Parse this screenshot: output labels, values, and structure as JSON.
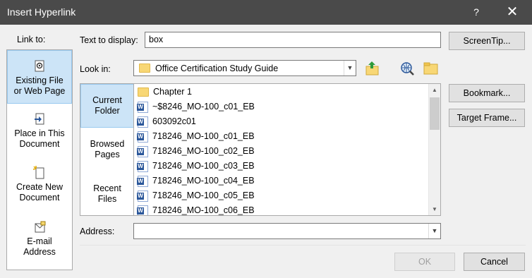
{
  "window": {
    "title": "Insert Hyperlink",
    "help_glyph": "?",
    "close_glyph": "✕"
  },
  "link_to": {
    "label": "Link to:",
    "items": [
      {
        "line1": "Existing File",
        "line2": "or Web Page",
        "icon": "existing-file-icon",
        "selected": true
      },
      {
        "line1": "Place in This",
        "line2": "Document",
        "icon": "place-in-document-icon",
        "selected": false
      },
      {
        "line1": "Create New",
        "line2": "Document",
        "icon": "create-new-document-icon",
        "selected": false
      },
      {
        "line1": "E-mail",
        "line2": "Address",
        "icon": "email-address-icon",
        "selected": false
      }
    ]
  },
  "text_to_display": {
    "label": "Text to display:",
    "value": "box"
  },
  "screentip": {
    "label": "ScreenTip..."
  },
  "look_in": {
    "label": "Look in:",
    "value": "Office Certification Study Guide",
    "icons": [
      "up-folder-icon",
      "browse-web-icon",
      "browse-file-icon"
    ]
  },
  "nav": {
    "items": [
      {
        "line1": "Current",
        "line2": "Folder",
        "selected": true
      },
      {
        "line1": "Browsed",
        "line2": "Pages",
        "selected": false
      },
      {
        "line1": "Recent",
        "line2": "Files",
        "selected": false
      }
    ]
  },
  "files": [
    {
      "name": "Chapter 1",
      "type": "folder"
    },
    {
      "name": "~$8246_MO-100_c01_EB",
      "type": "word"
    },
    {
      "name": "603092c01",
      "type": "word"
    },
    {
      "name": "718246_MO-100_c01_EB",
      "type": "word"
    },
    {
      "name": "718246_MO-100_c02_EB",
      "type": "word"
    },
    {
      "name": "718246_MO-100_c03_EB",
      "type": "word"
    },
    {
      "name": "718246_MO-100_c04_EB",
      "type": "word"
    },
    {
      "name": "718246_MO-100_c05_EB",
      "type": "word"
    },
    {
      "name": "718246_MO-100_c06_EB",
      "type": "word"
    }
  ],
  "side_buttons": {
    "bookmark": "Bookmark...",
    "target_frame": "Target Frame..."
  },
  "address": {
    "label": "Address:",
    "value": ""
  },
  "footer": {
    "ok": "OK",
    "cancel": "Cancel",
    "ok_enabled": false
  },
  "colors": {
    "titlebar": "#4a4a4a",
    "selection": "#cce4f7",
    "dialog_bg": "#f0f0f0",
    "folder": "#f8d775",
    "word": "#2b579a"
  }
}
